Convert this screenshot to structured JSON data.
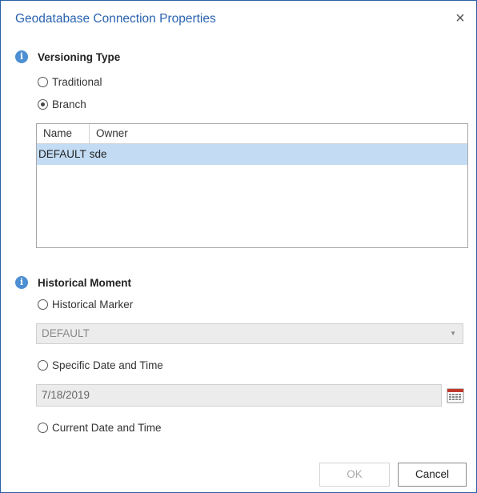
{
  "dialog": {
    "title": "Geodatabase Connection Properties",
    "close_glyph": "×"
  },
  "versioning": {
    "heading": "Versioning Type",
    "info_icon": "info-icon",
    "options": [
      {
        "label": "Traditional",
        "selected": false
      },
      {
        "label": "Branch",
        "selected": true
      }
    ],
    "list": {
      "columns": [
        "Name",
        "Owner"
      ],
      "rows": [
        {
          "name": "DEFAULT",
          "owner": "sde",
          "selected": true
        }
      ]
    }
  },
  "historical": {
    "heading": "Historical Moment",
    "info_icon": "info-icon",
    "marker_option": {
      "label": "Historical Marker",
      "selected": false
    },
    "marker_value": "DEFAULT",
    "specific_option": {
      "label": "Specific Date and Time",
      "selected": false
    },
    "date_value": "7/18/2019",
    "current_option": {
      "label": "Current Date and Time",
      "selected": false
    }
  },
  "buttons": {
    "ok": "OK",
    "cancel": "Cancel"
  },
  "colors": {
    "accent": "#2a63b0",
    "info_icon": "#4d8fd3",
    "selected_row": "#c3dcf4",
    "disabled_field": "#ececec"
  }
}
